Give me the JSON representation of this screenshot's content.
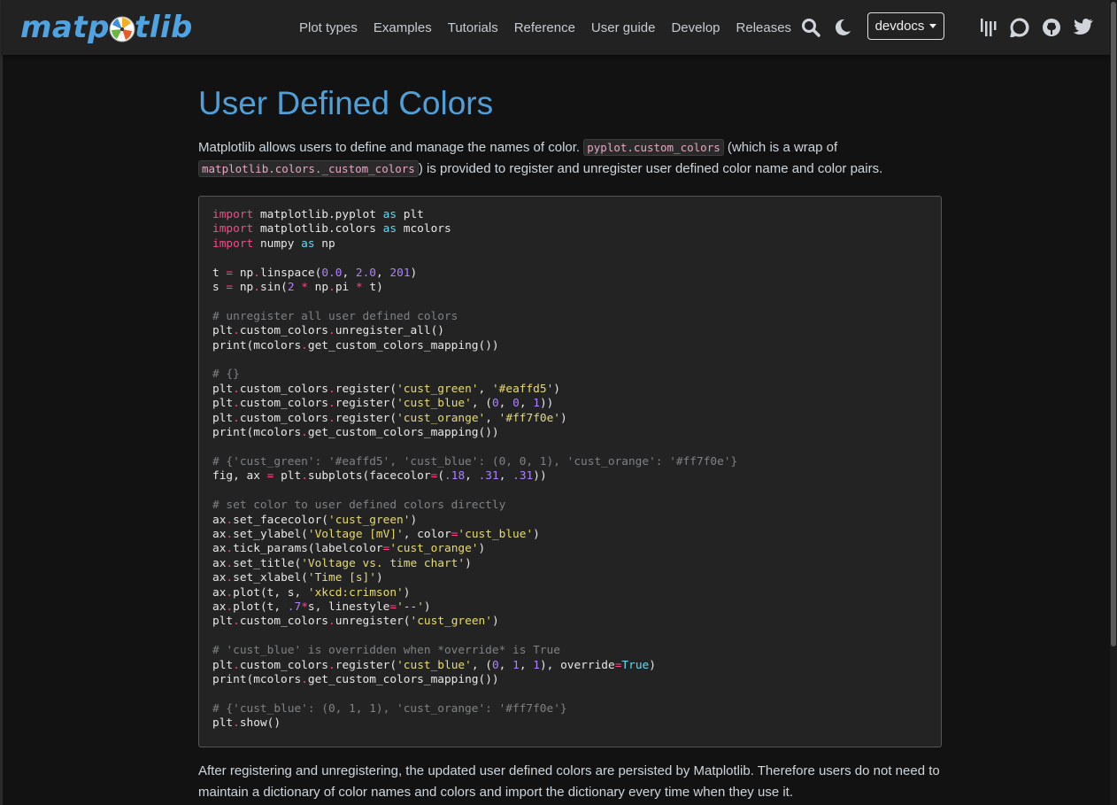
{
  "navbar": {
    "logo_text_left": "matp",
    "logo_text_right": "tlib",
    "links": [
      "Plot types",
      "Examples",
      "Tutorials",
      "Reference",
      "User guide",
      "Develop",
      "Releases"
    ],
    "version_label": "devdocs",
    "icons": [
      "search-icon",
      "moon-icon",
      "gitter-icon",
      "discourse-icon",
      "github-icon",
      "twitter-icon"
    ]
  },
  "page": {
    "title": "User Defined Colors",
    "intro_text_1": "Matplotlib allows users to define and manage the names of color. ",
    "intro_code_1": "pyplot.custom_colors",
    "intro_text_2": " (which is a wrap of ",
    "intro_code_2": "matplotlib.colors._custom_colors",
    "intro_text_3": ") is provided to register and unregister user defined color name and color pairs.",
    "outro_text": "After registering and unregistering, the updated user defined colors are persisted by Matplotlib. Therefore users do not need to maintain a dictionary of color names and colors and import the dictionary every time when they use it."
  },
  "code": {
    "lines": [
      [
        [
          "kw",
          "import"
        ],
        [
          "t",
          " matplotlib.pyplot "
        ],
        [
          "bi",
          "as"
        ],
        [
          "t",
          " plt"
        ]
      ],
      [
        [
          "kw",
          "import"
        ],
        [
          "t",
          " matplotlib.colors "
        ],
        [
          "bi",
          "as"
        ],
        [
          "t",
          " mcolors"
        ]
      ],
      [
        [
          "kw",
          "import"
        ],
        [
          "t",
          " numpy "
        ],
        [
          "bi",
          "as"
        ],
        [
          "t",
          " np"
        ]
      ],
      [],
      [
        [
          "t",
          "t "
        ],
        [
          "op",
          "="
        ],
        [
          "t",
          " np"
        ],
        [
          "op",
          "."
        ],
        [
          "t",
          "linspace("
        ],
        [
          "num",
          "0.0"
        ],
        [
          "t",
          ", "
        ],
        [
          "num",
          "2.0"
        ],
        [
          "t",
          ", "
        ],
        [
          "num",
          "201"
        ],
        [
          "t",
          ")"
        ]
      ],
      [
        [
          "t",
          "s "
        ],
        [
          "op",
          "="
        ],
        [
          "t",
          " np"
        ],
        [
          "op",
          "."
        ],
        [
          "t",
          "sin("
        ],
        [
          "num",
          "2"
        ],
        [
          "t",
          " "
        ],
        [
          "op",
          "*"
        ],
        [
          "t",
          " np"
        ],
        [
          "op",
          "."
        ],
        [
          "t",
          "pi "
        ],
        [
          "op",
          "*"
        ],
        [
          "t",
          " t)"
        ]
      ],
      [],
      [
        [
          "cm",
          "# unregister all user defined colors"
        ]
      ],
      [
        [
          "t",
          "plt"
        ],
        [
          "op",
          "."
        ],
        [
          "t",
          "custom_colors"
        ],
        [
          "op",
          "."
        ],
        [
          "t",
          "unregister_all()"
        ]
      ],
      [
        [
          "t",
          "print(mcolors"
        ],
        [
          "op",
          "."
        ],
        [
          "t",
          "get_custom_colors_mapping())"
        ]
      ],
      [],
      [
        [
          "cm",
          "# {}"
        ]
      ],
      [
        [
          "t",
          "plt"
        ],
        [
          "op",
          "."
        ],
        [
          "t",
          "custom_colors"
        ],
        [
          "op",
          "."
        ],
        [
          "t",
          "register("
        ],
        [
          "str",
          "'cust_green'"
        ],
        [
          "t",
          ", "
        ],
        [
          "str",
          "'#eaffd5'"
        ],
        [
          "t",
          ")"
        ]
      ],
      [
        [
          "t",
          "plt"
        ],
        [
          "op",
          "."
        ],
        [
          "t",
          "custom_colors"
        ],
        [
          "op",
          "."
        ],
        [
          "t",
          "register("
        ],
        [
          "str",
          "'cust_blue'"
        ],
        [
          "t",
          ", ("
        ],
        [
          "num",
          "0"
        ],
        [
          "t",
          ", "
        ],
        [
          "num",
          "0"
        ],
        [
          "t",
          ", "
        ],
        [
          "num",
          "1"
        ],
        [
          "t",
          "))"
        ]
      ],
      [
        [
          "t",
          "plt"
        ],
        [
          "op",
          "."
        ],
        [
          "t",
          "custom_colors"
        ],
        [
          "op",
          "."
        ],
        [
          "t",
          "register("
        ],
        [
          "str",
          "'cust_orange'"
        ],
        [
          "t",
          ", "
        ],
        [
          "str",
          "'#ff7f0e'"
        ],
        [
          "t",
          ")"
        ]
      ],
      [
        [
          "t",
          "print(mcolors"
        ],
        [
          "op",
          "."
        ],
        [
          "t",
          "get_custom_colors_mapping())"
        ]
      ],
      [],
      [
        [
          "cm",
          "# {'cust_green': '#eaffd5', 'cust_blue': (0, 0, 1), 'cust_orange': '#ff7f0e'}"
        ]
      ],
      [
        [
          "t",
          "fig, ax "
        ],
        [
          "op",
          "="
        ],
        [
          "t",
          " plt"
        ],
        [
          "op",
          "."
        ],
        [
          "t",
          "subplots(facecolor"
        ],
        [
          "op",
          "="
        ],
        [
          "t",
          "("
        ],
        [
          "num",
          ".18"
        ],
        [
          "t",
          ", "
        ],
        [
          "num",
          ".31"
        ],
        [
          "t",
          ", "
        ],
        [
          "num",
          ".31"
        ],
        [
          "t",
          "))"
        ]
      ],
      [],
      [
        [
          "cm",
          "# set color to user defined colors directly"
        ]
      ],
      [
        [
          "t",
          "ax"
        ],
        [
          "op",
          "."
        ],
        [
          "t",
          "set_facecolor("
        ],
        [
          "str",
          "'cust_green'"
        ],
        [
          "t",
          ")"
        ]
      ],
      [
        [
          "t",
          "ax"
        ],
        [
          "op",
          "."
        ],
        [
          "t",
          "set_ylabel("
        ],
        [
          "str",
          "'Voltage [mV]'"
        ],
        [
          "t",
          ", color"
        ],
        [
          "op",
          "="
        ],
        [
          "str",
          "'cust_blue'"
        ],
        [
          "t",
          ")"
        ]
      ],
      [
        [
          "t",
          "ax"
        ],
        [
          "op",
          "."
        ],
        [
          "t",
          "tick_params(labelcolor"
        ],
        [
          "op",
          "="
        ],
        [
          "str",
          "'cust_orange'"
        ],
        [
          "t",
          ")"
        ]
      ],
      [
        [
          "t",
          "ax"
        ],
        [
          "op",
          "."
        ],
        [
          "t",
          "set_title("
        ],
        [
          "str",
          "'Voltage vs. time chart'"
        ],
        [
          "t",
          ")"
        ]
      ],
      [
        [
          "t",
          "ax"
        ],
        [
          "op",
          "."
        ],
        [
          "t",
          "set_xlabel("
        ],
        [
          "str",
          "'Time [s]'"
        ],
        [
          "t",
          ")"
        ]
      ],
      [
        [
          "t",
          "ax"
        ],
        [
          "op",
          "."
        ],
        [
          "t",
          "plot(t, s, "
        ],
        [
          "str",
          "'xkcd:crimson'"
        ],
        [
          "t",
          ")"
        ]
      ],
      [
        [
          "t",
          "ax"
        ],
        [
          "op",
          "."
        ],
        [
          "t",
          "plot(t, "
        ],
        [
          "num",
          ".7"
        ],
        [
          "op",
          "*"
        ],
        [
          "t",
          "s, linestyle"
        ],
        [
          "op",
          "="
        ],
        [
          "str",
          "'--'"
        ],
        [
          "t",
          ")"
        ]
      ],
      [
        [
          "t",
          "plt"
        ],
        [
          "op",
          "."
        ],
        [
          "t",
          "custom_colors"
        ],
        [
          "op",
          "."
        ],
        [
          "t",
          "unregister("
        ],
        [
          "str",
          "'cust_green'"
        ],
        [
          "t",
          ")"
        ]
      ],
      [],
      [
        [
          "cm",
          "# 'cust_blue' is overridden when *override* is True"
        ]
      ],
      [
        [
          "t",
          "plt"
        ],
        [
          "op",
          "."
        ],
        [
          "t",
          "custom_colors"
        ],
        [
          "op",
          "."
        ],
        [
          "t",
          "register("
        ],
        [
          "str",
          "'cust_blue'"
        ],
        [
          "t",
          ", ("
        ],
        [
          "num",
          "0"
        ],
        [
          "t",
          ", "
        ],
        [
          "num",
          "1"
        ],
        [
          "t",
          ", "
        ],
        [
          "num",
          "1"
        ],
        [
          "t",
          "), override"
        ],
        [
          "op",
          "="
        ],
        [
          "bi",
          "True"
        ],
        [
          "t",
          ")"
        ]
      ],
      [
        [
          "t",
          "print(mcolors"
        ],
        [
          "op",
          "."
        ],
        [
          "t",
          "get_custom_colors_mapping())"
        ]
      ],
      [],
      [
        [
          "cm",
          "# {'cust_blue': (0, 1, 1), 'cust_orange': '#ff7f0e'}"
        ]
      ],
      [
        [
          "t",
          "plt"
        ],
        [
          "op",
          "."
        ],
        [
          "t",
          "show()"
        ]
      ]
    ]
  },
  "colors": {
    "background": "#121212",
    "navbar": "#222222",
    "title": "#4f9fd8",
    "logo": "#4fa3e0"
  }
}
